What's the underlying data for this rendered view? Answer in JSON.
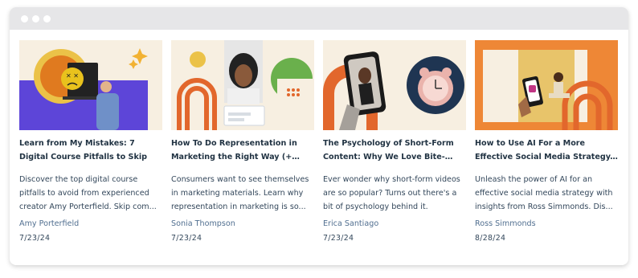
{
  "window": {
    "titlebar_color": "#e6e6e8",
    "dots": [
      "window-dot-1",
      "window-dot-2",
      "window-dot-3"
    ]
  },
  "colors": {
    "title": "#213343",
    "excerpt": "#33475b",
    "author": "#516f90"
  },
  "cards": [
    {
      "title": "Learn from My Mistakes: 7 Digital Course Pitfalls to Skip",
      "excerpt": "Discover the top digital course pitfalls to avoid from experienced creator Amy Porterfield. Skip com...",
      "author": "Amy Porterfield",
      "date": "7/23/24"
    },
    {
      "title": "How To Do Representation in Marketing the Right Way (+ Consu...",
      "excerpt": "Consumers want to see themselves in marketing materials. Learn why representation in marketing is so...",
      "author": "Sonia Thompson",
      "date": "7/23/24"
    },
    {
      "title": "The Psychology of Short-Form Content: Why We Love Bite-Sized...",
      "excerpt": "Ever wonder why short-form videos are so popular? Turns out there's a bit of psychology behind it.",
      "author": "Erica Santiago",
      "date": "7/23/24"
    },
    {
      "title": "How to Use AI For a More Effective Social Media Strategy, Ac...",
      "excerpt": "Unleash the power of AI for an effective social media strategy with insights from Ross Simmonds. Dis...",
      "author": "Ross Simmonds",
      "date": "8/28/24"
    }
  ]
}
